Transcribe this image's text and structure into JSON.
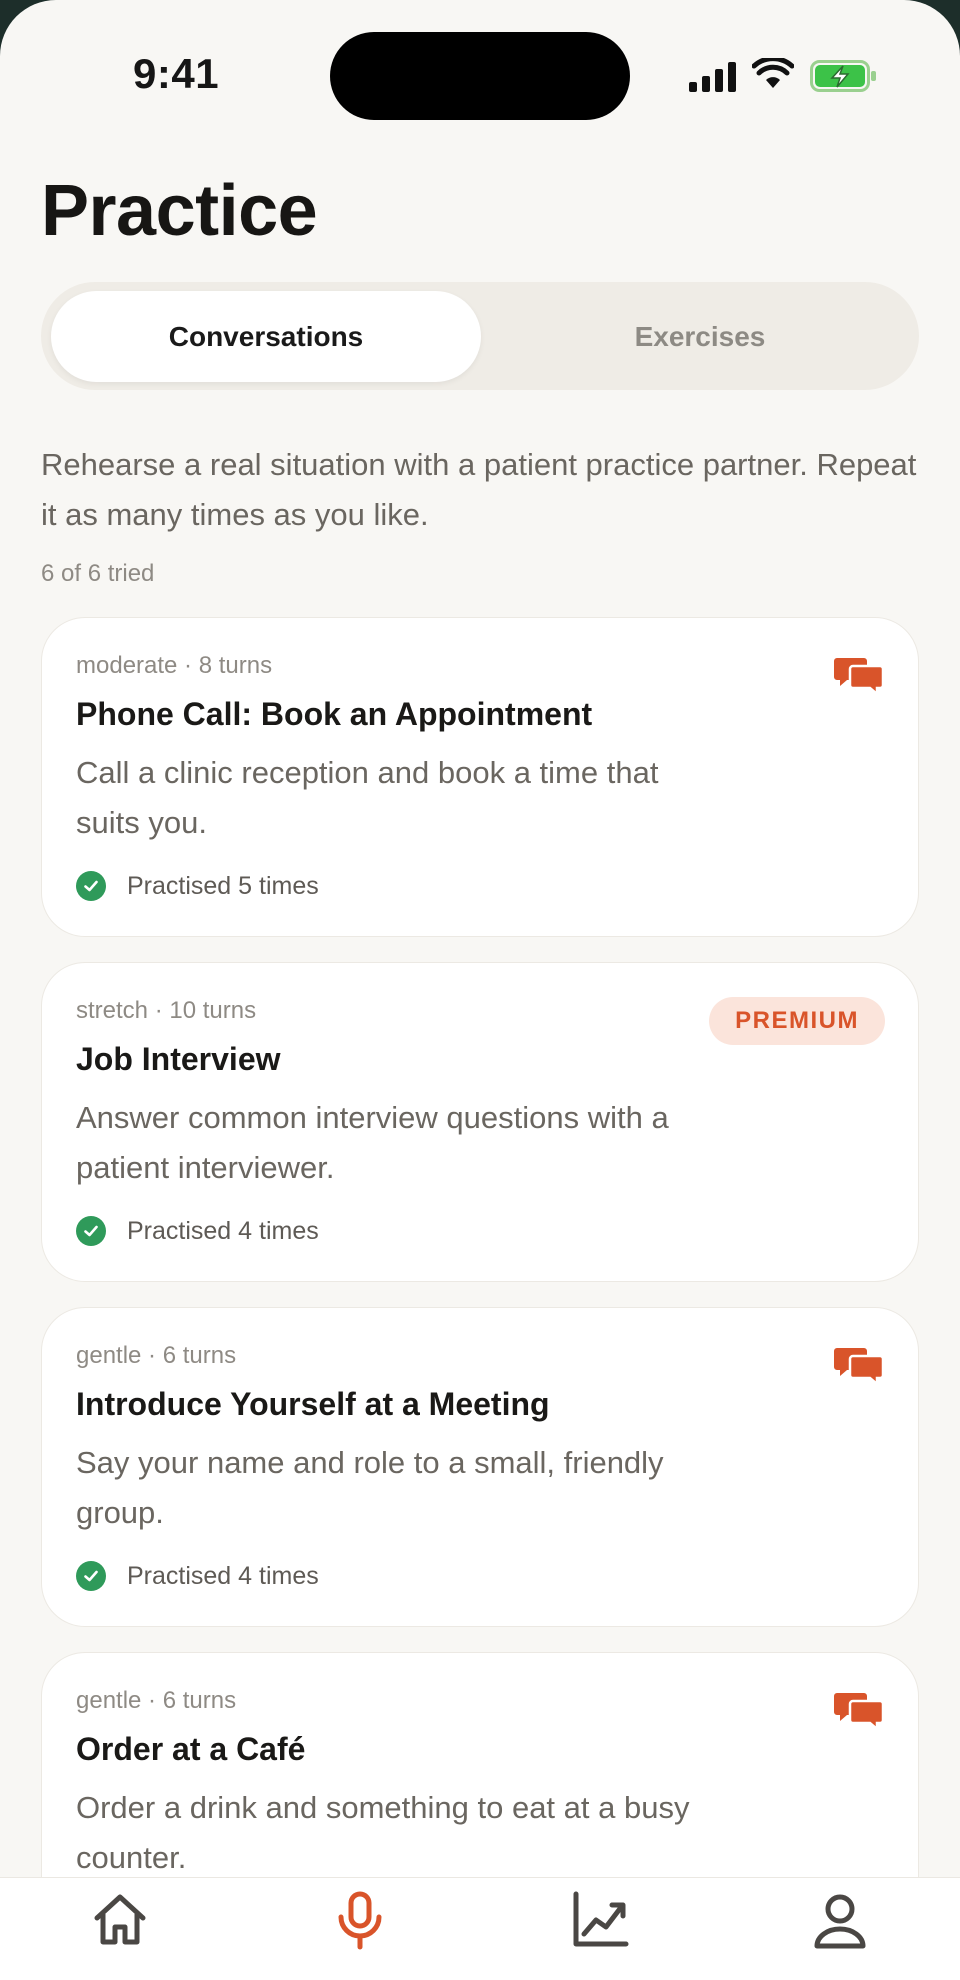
{
  "status_bar": {
    "time": "9:41"
  },
  "header": {
    "title": "Practice"
  },
  "segments": {
    "active": "Conversations",
    "inactive": "Exercises"
  },
  "intro": {
    "text": "Rehearse a real situation with a patient practice partner. Repeat it as many times as you like.",
    "progress": "6 of 6 tried"
  },
  "cards": [
    {
      "meta": "moderate · 8 turns",
      "title": "Phone Call: Book an Appointment",
      "desc": "Call a clinic reception and book a time that suits you.",
      "status": "Practised 5 times",
      "icon": "chat-bubbles-icon"
    },
    {
      "meta": "stretch · 10 turns",
      "title": "Job Interview",
      "desc": "Answer common interview questions with a patient interviewer.",
      "status": "Practised 4 times",
      "badge": "PREMIUM"
    },
    {
      "meta": "gentle · 6 turns",
      "title": "Introduce Yourself at a Meeting",
      "desc": "Say your name and role to a small, friendly group.",
      "status": "Practised 4 times",
      "icon": "chat-bubbles-icon"
    },
    {
      "meta": "gentle · 6 turns",
      "title": "Order at a Café",
      "desc": "Order a drink and something to eat at a busy counter.",
      "icon": "chat-bubbles-icon"
    }
  ],
  "tabbar": {
    "items": [
      "home-icon",
      "microphone-icon",
      "chart-icon",
      "profile-icon"
    ],
    "active": "microphone-icon"
  },
  "colors": {
    "accent": "#d9542a",
    "success": "#2f9a5a",
    "background": "#f8f7f4",
    "card": "#ffffff",
    "text_primary": "#1a1917",
    "text_secondary": "#6a6660"
  }
}
